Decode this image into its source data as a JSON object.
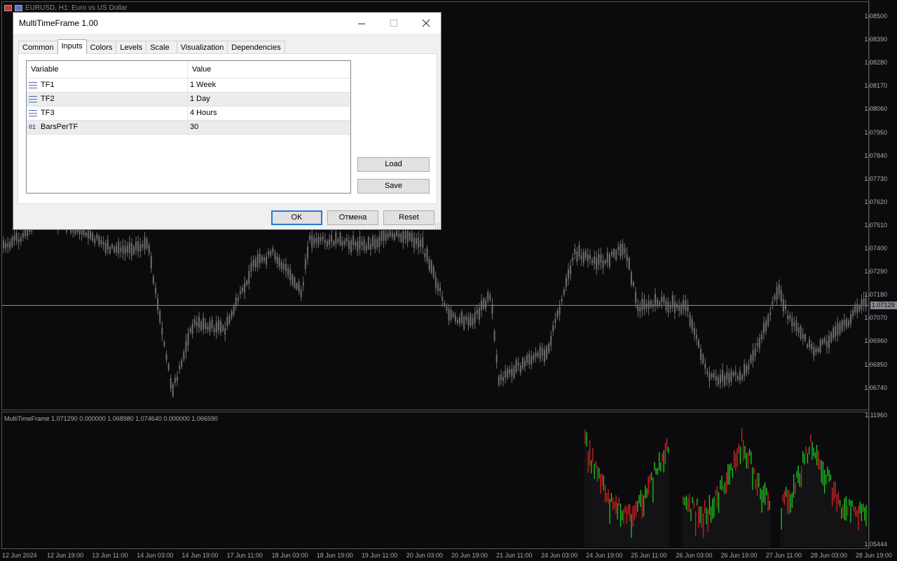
{
  "chart": {
    "title": "EURUSD, H1:  Euro vs US Dollar",
    "current_price": "1.07129",
    "price_axis": [
      "1.08500",
      "1.08390",
      "1.08280",
      "1.08170",
      "1.08060",
      "1.07950",
      "1.07840",
      "1.07730",
      "1.07620",
      "1.07510",
      "1.07400",
      "1.07290",
      "1.07180",
      "1.07070",
      "1.06960",
      "1.06850",
      "1.06740"
    ],
    "sub_axis": [
      "1.11960",
      "1.05444"
    ],
    "time_axis": [
      "12 Jun 2024",
      "12 Jun 19:00",
      "13 Jun 11:00",
      "14 Jun 03:00",
      "14 Jun 19:00",
      "17 Jun 11:00",
      "18 Jun 03:00",
      "18 Jun 19:00",
      "19 Jun 11:00",
      "20 Jun 03:00",
      "20 Jun 19:00",
      "21 Jun 11:00",
      "24 Jun 03:00",
      "24 Jun 19:00",
      "25 Jun 11:00",
      "26 Jun 03:00",
      "26 Jun 19:00",
      "27 Jun 11:00",
      "28 Jun 03:00",
      "28 Jun 19:00"
    ],
    "indicator_title": "MultiTimeFrame 1.071290 0.000000 1.068980 1.074640 0.000000 1.066590",
    "colors": {
      "bull": "#22cc22",
      "bear": "#dd2222",
      "candle": "#6e6e6e",
      "bg": "#0b0b0e"
    }
  },
  "dialog": {
    "title": "MultiTimeFrame 1.00",
    "tabs": [
      "Common",
      "Inputs",
      "Colors",
      "Levels",
      "Scale",
      "Visualization",
      "Dependencies"
    ],
    "active_tab": "Inputs",
    "grid": {
      "headers": {
        "variable": "Variable",
        "value": "Value"
      },
      "rows": [
        {
          "icon": "enum-icon",
          "variable": "TF1",
          "value": "1 Week"
        },
        {
          "icon": "enum-icon",
          "variable": "TF2",
          "value": "1 Day"
        },
        {
          "icon": "enum-icon",
          "variable": "TF3",
          "value": "4 Hours"
        },
        {
          "icon": "int-icon",
          "icon_text": "01",
          "variable": "BarsPerTF",
          "value": "30"
        }
      ]
    },
    "buttons": {
      "load": "Load",
      "save": "Save",
      "ok": "OK",
      "cancel": "Отмена",
      "reset": "Reset"
    }
  }
}
